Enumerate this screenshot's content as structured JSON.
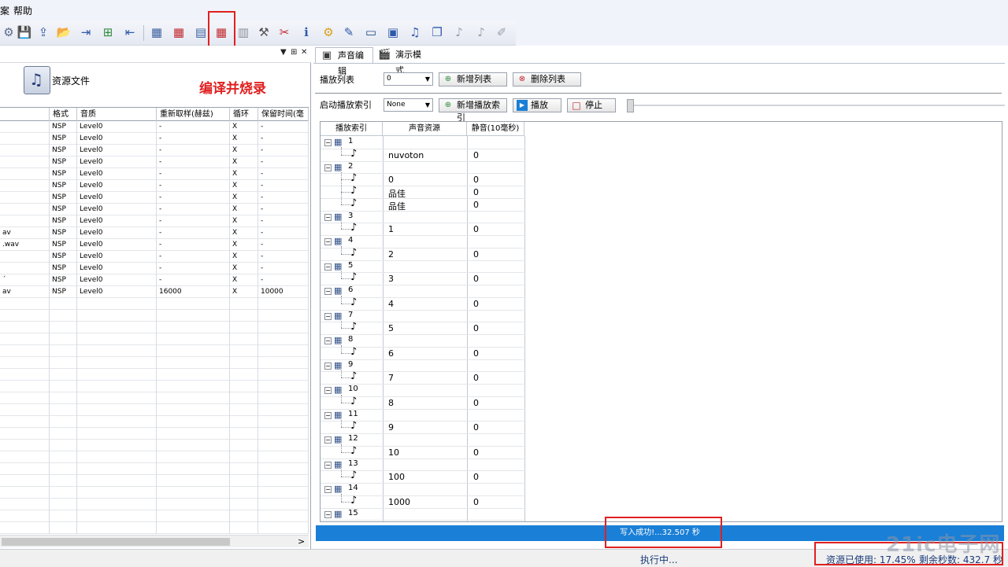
{
  "menu": {
    "items": [
      "案",
      "帮助"
    ]
  },
  "toolbar": {
    "icons": [
      "open-project-icon",
      "save-project-icon",
      "export-icon",
      "open-folder-icon",
      "import-icon",
      "add-resource-icon",
      "remove-resource-icon",
      "compile-icon",
      "compile-burn-icon",
      "burn-icon",
      "compile-and-burn-icon",
      "delete-list-icon",
      "tools-icon",
      "disconnect-icon",
      "info-icon",
      "settings-icon",
      "edit-icon",
      "terminal-icon",
      "chip-icon",
      "audio-icon",
      "copy-icon",
      "note-icon",
      "note-disabled-icon",
      "clear-icon"
    ]
  },
  "annotation": {
    "text": "编译并烧录"
  },
  "left_panel": {
    "header_buttons": [
      "▼",
      "⊞",
      "✕"
    ],
    "resource_label": "资源文件",
    "columns": [
      "",
      "格式",
      "音质",
      "重新取样(赫兹)",
      "循环",
      "保留时间(毫"
    ],
    "rows": [
      [
        "",
        "NSP",
        "Level0",
        "-",
        "X",
        "-"
      ],
      [
        "",
        "NSP",
        "Level0",
        "-",
        "X",
        "-"
      ],
      [
        "",
        "NSP",
        "Level0",
        "-",
        "X",
        "-"
      ],
      [
        "",
        "NSP",
        "Level0",
        "-",
        "X",
        "-"
      ],
      [
        "",
        "NSP",
        "Level0",
        "-",
        "X",
        "-"
      ],
      [
        "",
        "NSP",
        "Level0",
        "-",
        "X",
        "-"
      ],
      [
        "",
        "NSP",
        "Level0",
        "-",
        "X",
        "-"
      ],
      [
        "",
        "NSP",
        "Level0",
        "-",
        "X",
        "-"
      ],
      [
        "",
        "NSP",
        "Level0",
        "-",
        "X",
        "-"
      ],
      [
        "av",
        "NSP",
        "Level0",
        "-",
        "X",
        "-"
      ],
      [
        ".wav",
        "NSP",
        "Level0",
        "-",
        "X",
        "-"
      ],
      [
        "",
        "NSP",
        "Level0",
        "-",
        "X",
        "-"
      ],
      [
        "",
        "NSP",
        "Level0",
        "-",
        "X",
        "-"
      ],
      [
        "´",
        "NSP",
        "Level0",
        "-",
        "X",
        "-"
      ],
      [
        "av",
        "NSP",
        "Level0",
        "16000",
        "X",
        "10000"
      ]
    ],
    "scroll_right": ">"
  },
  "right_panel": {
    "tabs": [
      "声音编辑",
      "演示模式"
    ],
    "playlist_label": "播放列表",
    "playlist_value": "0",
    "new_list_button": "新增列表",
    "delete_list_button": "删除列表",
    "start_index_label": "启动播放索引",
    "start_index_value": "None",
    "new_index_button": "新增播放索引",
    "play_button": "播放",
    "stop_button": "停止",
    "tree_columns": [
      "播放索引",
      "声音资源",
      "静音(10毫秒)"
    ],
    "tree": [
      {
        "index": "1",
        "children": [
          [
            "nuvoton",
            "0"
          ]
        ]
      },
      {
        "index": "2",
        "children": [
          [
            "0",
            "0"
          ],
          [
            "品佳",
            "0"
          ],
          [
            "品佳",
            "0"
          ]
        ]
      },
      {
        "index": "3",
        "children": [
          [
            "1",
            "0"
          ]
        ]
      },
      {
        "index": "4",
        "children": [
          [
            "2",
            "0"
          ]
        ]
      },
      {
        "index": "5",
        "children": [
          [
            "3",
            "0"
          ]
        ]
      },
      {
        "index": "6",
        "children": [
          [
            "4",
            "0"
          ]
        ]
      },
      {
        "index": "7",
        "children": [
          [
            "5",
            "0"
          ]
        ]
      },
      {
        "index": "8",
        "children": [
          [
            "6",
            "0"
          ]
        ]
      },
      {
        "index": "9",
        "children": [
          [
            "7",
            "0"
          ]
        ]
      },
      {
        "index": "10",
        "children": [
          [
            "8",
            "0"
          ]
        ]
      },
      {
        "index": "11",
        "children": [
          [
            "9",
            "0"
          ]
        ]
      },
      {
        "index": "12",
        "children": [
          [
            "10",
            "0"
          ]
        ]
      },
      {
        "index": "13",
        "children": [
          [
            "100",
            "0"
          ]
        ]
      },
      {
        "index": "14",
        "children": [
          [
            "1000",
            "0"
          ]
        ]
      },
      {
        "index": "15",
        "children": []
      }
    ]
  },
  "progress": {
    "text": "写入成功!...32.507 秒"
  },
  "status": {
    "running": "执行中...",
    "resource_used": "资源已使用: 17.45%",
    "remaining": "剩余秒数: 432.7 秒"
  },
  "watermark": "21ic电子网",
  "colors": {
    "accent": "#1a7fd6",
    "highlight": "#e02020"
  }
}
